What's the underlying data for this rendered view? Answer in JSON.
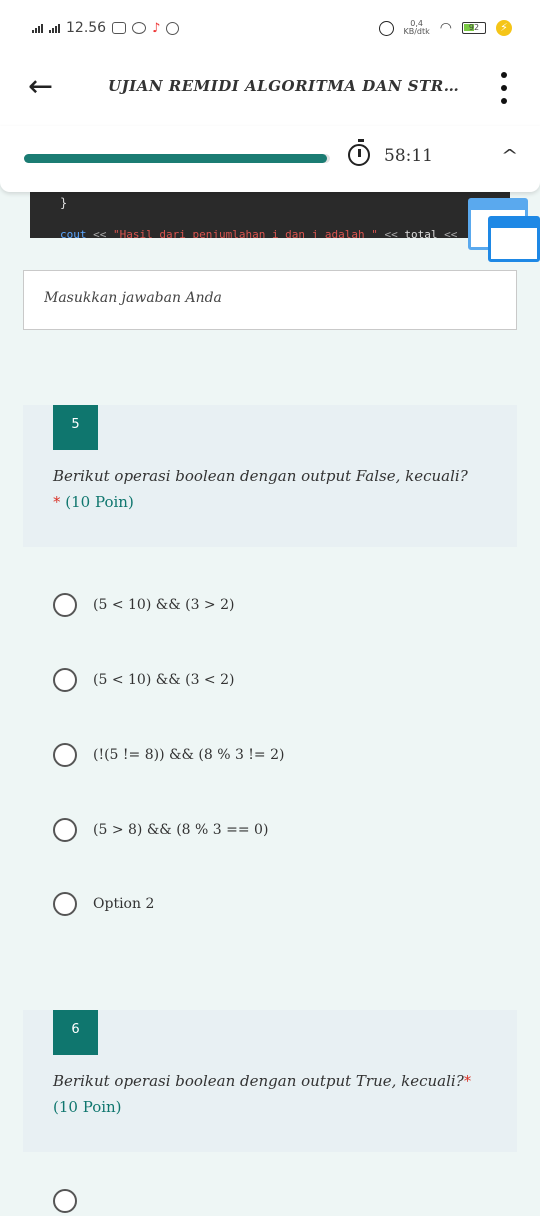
{
  "status_bar": {
    "time": "12.56",
    "speed_value": "0,4",
    "speed_unit": "KB/dtk",
    "battery": "92"
  },
  "header": {
    "title": "UJIAN REMIDI ALGORITMA DAN STRUK..."
  },
  "progress": {
    "value": 0.99,
    "timer": "58:11"
  },
  "code_snippet": {
    "brace": "}",
    "keyword": "cout",
    "op1": "<<",
    "string": "\"Hasil dari penjumlahan i dan j adalah \"",
    "op2": "<<",
    "variable": "total",
    "op3": "<<"
  },
  "answer_field": {
    "placeholder": "Masukkan jawaban Anda"
  },
  "questions": [
    {
      "number": "5",
      "text": "Berikut operasi boolean dengan output False, kecuali?",
      "required": "*",
      "points": "(10 Poin)",
      "options": [
        "(5 < 10) && (3 > 2)",
        "(5 < 10) && (3 < 2)",
        "(!(5 != 8)) && (8 % 3 != 2)",
        "(5 > 8) && (8 % 3 == 0)",
        "Option 2"
      ]
    },
    {
      "number": "6",
      "text": "Berikut operasi boolean dengan output True, kecuali?",
      "required": "*",
      "points": "(10 Poin)"
    }
  ]
}
